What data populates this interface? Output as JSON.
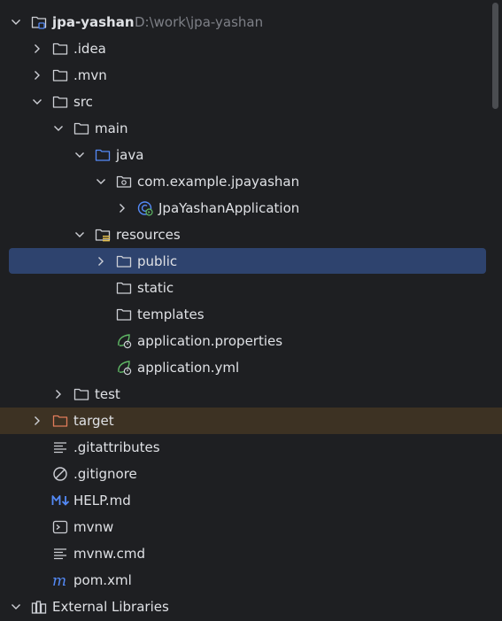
{
  "project": {
    "name": "jpa-yashan",
    "path": "D:\\work\\jpa-yashan"
  },
  "tree": {
    "idea": ".idea",
    "mvn": ".mvn",
    "src": "src",
    "main": "main",
    "java": "java",
    "package": "com.example.jpayashan",
    "app_class": "JpaYashanApplication",
    "resources": "resources",
    "public": "public",
    "static": "static",
    "templates": "templates",
    "app_properties": "application.properties",
    "app_yml": "application.yml",
    "test": "test",
    "target": "target",
    "gitattributes": ".gitattributes",
    "gitignore": ".gitignore",
    "help_md": "HELP.md",
    "mvnw": "mvnw",
    "mvnw_cmd": "mvnw.cmd",
    "pom": "pom.xml",
    "external_libraries": "External Libraries"
  },
  "colors": {
    "background": "#1e1f22",
    "selection": "#2e436e",
    "excluded_row": "#3d3223",
    "text": "#dfe1e5",
    "path_text": "#7e8087",
    "folder_stroke": "#ced0d6",
    "source_folder": "#548af7",
    "spring_green": "#5fb865",
    "target_folder": "#e07c5a",
    "markdown": "#548af7"
  },
  "icons": {
    "module": "module-folder-icon",
    "folder": "folder-icon",
    "source_root": "source-folder-icon",
    "package": "package-icon",
    "spring_class": "spring-boot-class-icon",
    "resources_root": "resources-folder-icon",
    "spring_config": "spring-config-icon",
    "excluded_folder": "excluded-folder-icon",
    "text_file": "text-file-icon",
    "ignore_file": "ignore-file-icon",
    "markdown_file": "markdown-icon",
    "shell_file": "shell-script-icon",
    "maven_file": "maven-icon",
    "libraries": "libraries-icon",
    "chevron_down": "chevron-down-icon",
    "chevron_right": "chevron-right-icon"
  }
}
